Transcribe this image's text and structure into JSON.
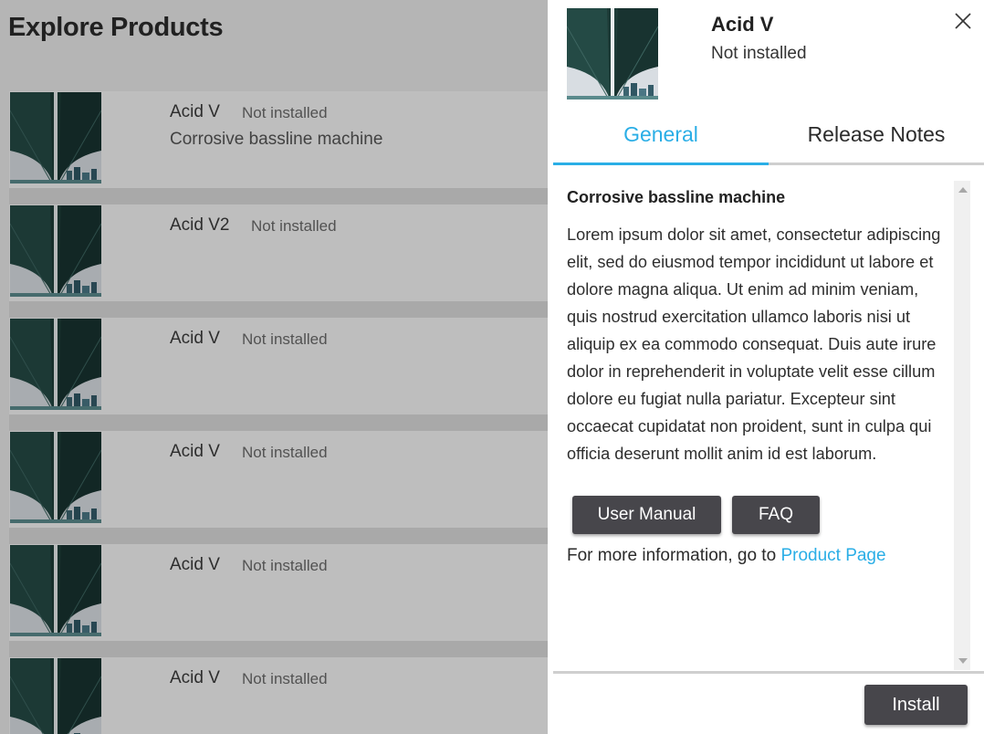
{
  "page": {
    "title": "Explore Products"
  },
  "products": [
    {
      "name": "Acid V",
      "status": "Not installed",
      "description": "Corrosive bassline machine"
    },
    {
      "name": "Acid V2",
      "status": "Not installed",
      "description": ""
    },
    {
      "name": "Acid V",
      "status": "Not installed",
      "description": ""
    },
    {
      "name": "Acid V",
      "status": "Not installed",
      "description": ""
    },
    {
      "name": "Acid V",
      "status": "Not installed",
      "description": ""
    },
    {
      "name": "Acid V",
      "status": "Not installed",
      "description": ""
    }
  ],
  "detail": {
    "name": "Acid V",
    "status": "Not installed",
    "tabs": [
      "General",
      "Release Notes"
    ],
    "active_tab": "General",
    "heading": "Corrosive bassline machine",
    "body": "Lorem ipsum dolor sit amet, consectetur adipiscing elit, sed do eiusmod tempor incididunt ut labore et dolore magna aliqua. Ut enim ad minim veniam, quis nostrud exercitation ullamco laboris nisi ut aliquip ex ea commodo consequat. Duis aute irure dolor in reprehenderit in voluptate velit esse cillum dolore eu fugiat nulla pariatur. Excepteur sint occaecat cupidatat non proident, sunt in culpa qui officia deserunt mollit anim id est laborum.",
    "user_manual_label": "User Manual",
    "faq_label": "FAQ",
    "more_info_prefix": "For more information, go to",
    "product_page_link": "Product Page",
    "install_label": "Install"
  },
  "colors": {
    "accent": "#2aaee6",
    "button_dark": "#47464b"
  },
  "icons": {
    "close": "close-icon",
    "scroll_up": "scroll-up-icon",
    "scroll_down": "scroll-down-icon"
  }
}
